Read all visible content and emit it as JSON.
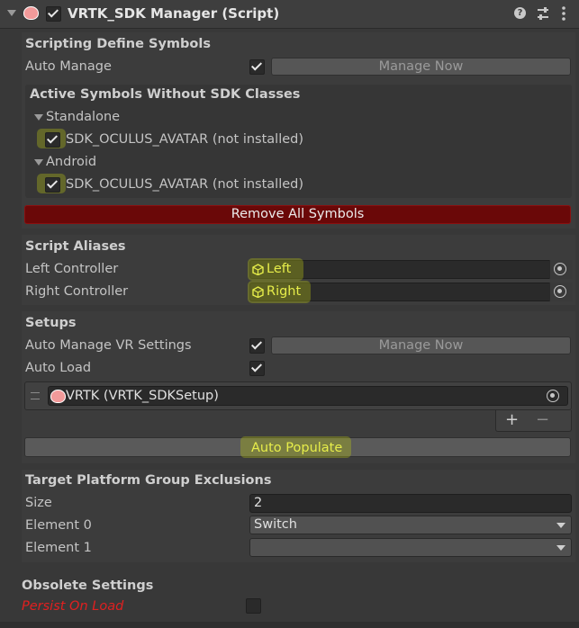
{
  "header": {
    "title": "VRTK_SDK Manager (Script)",
    "enabled": true
  },
  "scripting_define_symbols": {
    "title": "Scripting Define Symbols",
    "auto_manage_label": "Auto Manage",
    "auto_manage_checked": true,
    "manage_now_label": "Manage Now",
    "active_symbols_title": "Active Symbols Without SDK Classes",
    "groups": [
      {
        "name": "Standalone",
        "symbol": "SDK_OCULUS_AVATAR (not installed)",
        "checked": true
      },
      {
        "name": "Android",
        "symbol": "SDK_OCULUS_AVATAR (not installed)",
        "checked": true
      }
    ],
    "remove_all_label": "Remove All Symbols"
  },
  "script_aliases": {
    "title": "Script Aliases",
    "left_label": "Left Controller",
    "left_value": "Left",
    "right_label": "Right Controller",
    "right_value": "Right"
  },
  "setups": {
    "title": "Setups",
    "auto_manage_vr_label": "Auto Manage VR Settings",
    "auto_manage_vr_checked": true,
    "manage_now_label": "Manage Now",
    "auto_load_label": "Auto Load",
    "auto_load_checked": true,
    "list_item": "VRTK (VRTK_SDKSetup)",
    "add_label": "+",
    "remove_label": "−",
    "auto_populate_label": "Auto Populate"
  },
  "target_platform": {
    "title": "Target Platform Group Exclusions",
    "size_label": "Size",
    "size_value": "2",
    "element0_label": "Element 0",
    "element0_value": "Switch",
    "element1_label": "Element 1",
    "element1_value": ""
  },
  "obsolete": {
    "title": "Obsolete Settings",
    "persist_label": "Persist On Load",
    "persist_checked": false
  },
  "colors": {
    "background": "#383838",
    "remove_button": "#6a0808",
    "highlight": "#b7c414",
    "obsolete_label": "#e02020"
  }
}
